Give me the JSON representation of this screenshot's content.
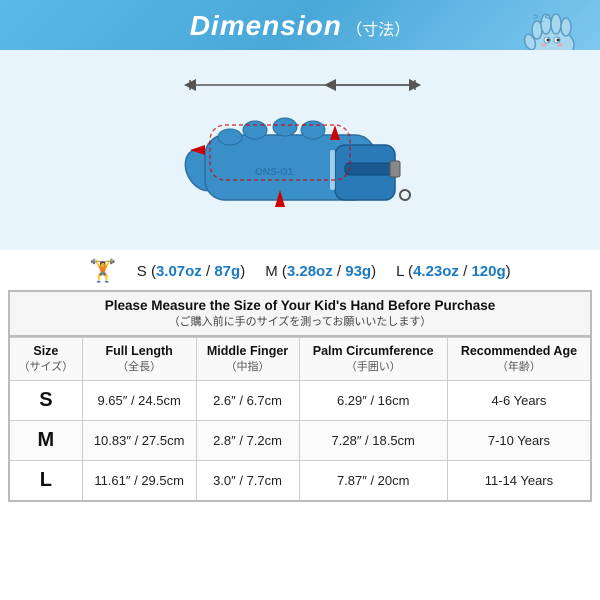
{
  "header": {
    "title": "Dimension",
    "subtitle": "（寸法）"
  },
  "weights": {
    "label_icon": "⚖",
    "s": {
      "size": "S",
      "oz": "3.07oz",
      "g": "87g"
    },
    "m": {
      "size": "M",
      "oz": "3.28oz",
      "g": "93g"
    },
    "l": {
      "size": "L",
      "oz": "4.23oz",
      "g": "120g"
    }
  },
  "table": {
    "notice_main": "Please Measure the Size of Your Kid's Hand Before Purchase",
    "notice_sub": "（ご購入前に手のサイズを測ってお願いいたします）",
    "columns": [
      {
        "label": "Size",
        "sub": "（サイズ）"
      },
      {
        "label": "Full Length",
        "sub": "（全長）"
      },
      {
        "label": "Middle Finger",
        "sub": "（中指）"
      },
      {
        "label": "Palm Circumference",
        "sub": "（手囲い）"
      },
      {
        "label": "Recommended Age",
        "sub": "（年齢）"
      }
    ],
    "rows": [
      {
        "size": "S",
        "full_length": "9.65″ / 24.5cm",
        "middle_finger": "2.6″ / 6.7cm",
        "palm_circumference": "6.29″ / 16cm",
        "age": "4-6 Years"
      },
      {
        "size": "M",
        "full_length": "10.83″ / 27.5cm",
        "middle_finger": "2.8″ / 7.2cm",
        "palm_circumference": "7.28″ / 18.5cm",
        "age": "7-10 Years"
      },
      {
        "size": "L",
        "full_length": "11.61″ / 29.5cm",
        "middle_finger": "3.0″ / 7.7cm",
        "palm_circumference": "7.87″ / 20cm",
        "age": "11-14 Years"
      }
    ]
  },
  "colors": {
    "header_bg": "#5ab6e8",
    "accent_blue": "#1a7ac4"
  }
}
